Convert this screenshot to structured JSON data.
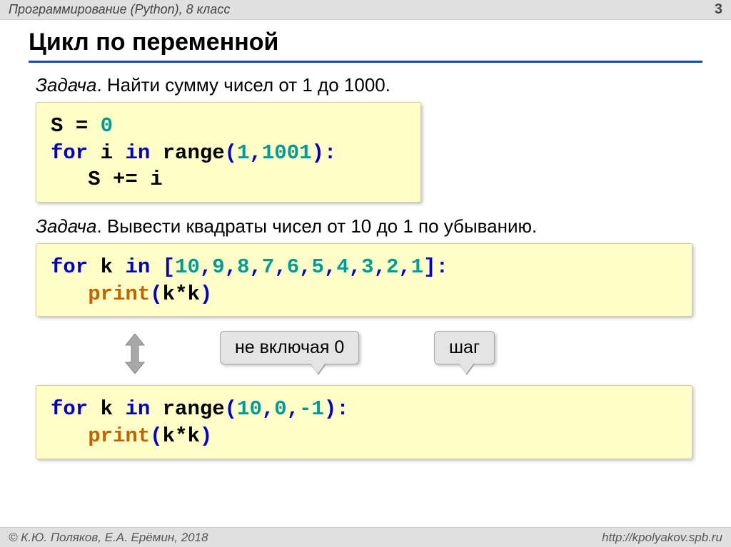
{
  "header": {
    "course": "Программирование (Python), 8 класс",
    "page": "3"
  },
  "title": "Цикл по переменной",
  "task1": {
    "label": "Задача",
    "text": ". Найти сумму чисел от 1 до 1000."
  },
  "code1": {
    "l1a": "S ",
    "l1b": "=",
    "l1c": " ",
    "l1d": "0",
    "l2a": "for",
    "l2b": " i ",
    "l2c": "in",
    "l2d": " range",
    "l2e": "(",
    "l2f": "1",
    "l2g": ",",
    "l2h": "1001",
    "l2i": "):",
    "l3a": "   S ",
    "l3b": "+=",
    "l3c": " i"
  },
  "task2": {
    "label": "Задача",
    "text": ". Вывести квадраты чисел от 10 до 1 по убыванию."
  },
  "code2": {
    "l1a": "for",
    "l1b": " k ",
    "l1c": "in",
    "l1d": " ",
    "l1e": "[",
    "l1f": "10",
    "l1g": ",",
    "l1h": "9",
    "l1i": ",",
    "l1j": "8",
    "l1k": ",",
    "l1l": "7",
    "l1m": ",",
    "l1n": "6",
    "l1o": ",",
    "l1p": "5",
    "l1q": ",",
    "l1r": "4",
    "l1s": ",",
    "l1t": "3",
    "l1u": ",",
    "l1v": "2",
    "l1w": ",",
    "l1x": "1",
    "l1y": "]:",
    "l2a": "   print",
    "l2b": "(",
    "l2c": "k",
    "l2d": "*",
    "l2e": "k",
    "l2f": ")"
  },
  "callouts": {
    "c1": "не включая 0",
    "c2": "шаг"
  },
  "code3": {
    "l1a": "for",
    "l1b": " k ",
    "l1c": "in",
    "l1d": " range",
    "l1e": "(",
    "l1f": "10",
    "l1g": ",",
    "l1h": "0",
    "l1i": ",",
    "l1j": "-1",
    "l1k": "):",
    "l2a": "   print",
    "l2b": "(",
    "l2c": "k",
    "l2d": "*",
    "l2e": "k",
    "l2f": ")"
  },
  "footer": {
    "copyright": "© К.Ю. Поляков, Е.А. Ерёмин, 2018",
    "url": "http://kpolyakov.spb.ru"
  }
}
